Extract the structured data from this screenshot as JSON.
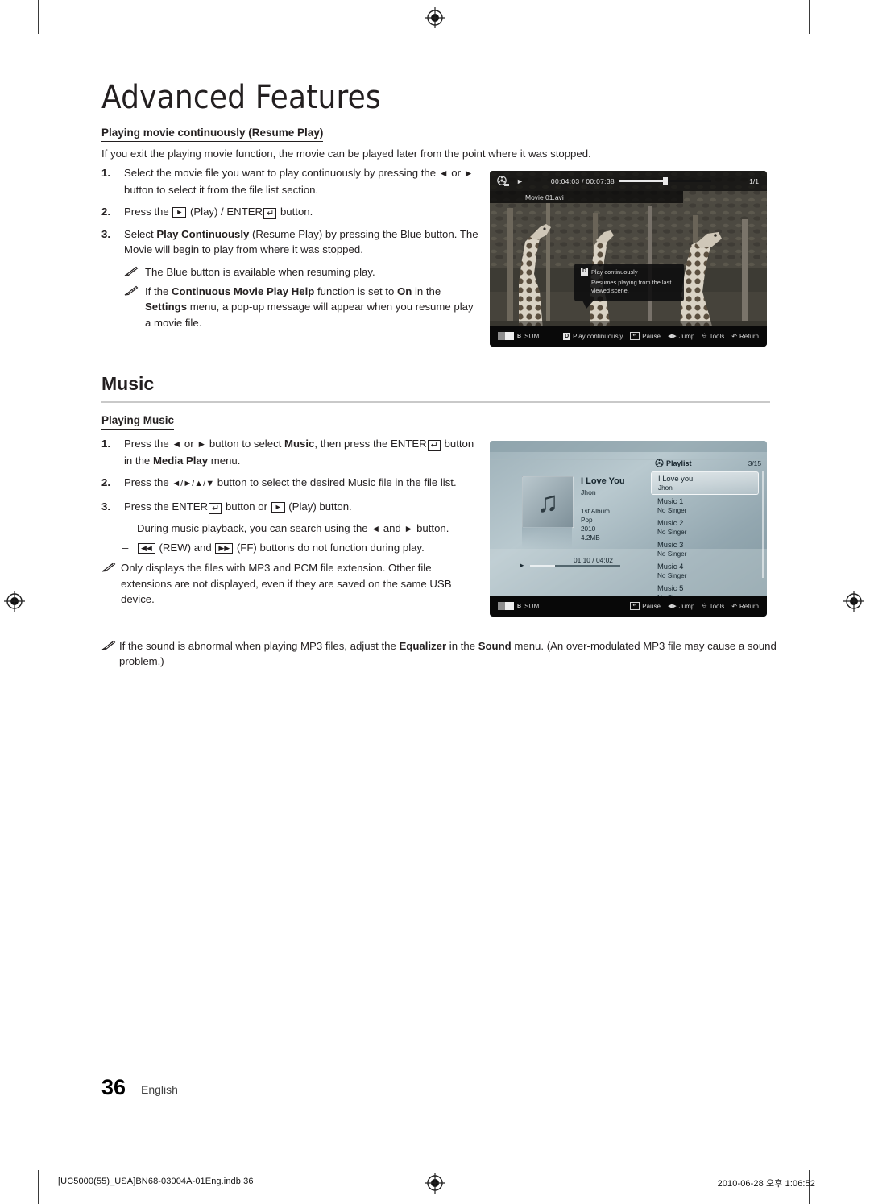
{
  "chapter": {
    "title": "Advanced Features"
  },
  "resume": {
    "heading": "Playing movie continuously (Resume Play)",
    "intro": "If you exit the playing movie function, the movie can be played later from the point where it was stopped.",
    "steps": [
      {
        "num": "1.",
        "text_a": "Select the movie file you want to play continuously by pressing the ",
        "text_b": " or ",
        "text_c": " button to select it from the file list section."
      },
      {
        "num": "2.",
        "text_a": "Press the ",
        "text_b": " (Play) / ENTER",
        "text_c": " button."
      },
      {
        "num": "3.",
        "text_a": "Select ",
        "bold": "Play Continuously",
        "text_b": " (Resume Play) by pressing the Blue button. The Movie will begin to play from where it was stopped."
      }
    ],
    "notes": [
      {
        "text": "The Blue button is available when resuming play."
      },
      {
        "pre": "If the ",
        "b1": "Continuous Movie Play Help",
        "mid": " function is set to ",
        "b2": "On",
        "mid2": " in the ",
        "b3": "Settings",
        "post": " menu, a pop-up message will appear when you resume play a movie file."
      }
    ]
  },
  "music_section": {
    "title": "Music",
    "heading": "Playing Music",
    "steps": [
      {
        "num": "1.",
        "a": "Press the ",
        "b": " or ",
        "c": " button to select ",
        "bold1": "Music",
        "d": ", then press the ENTER",
        "e": " button in the ",
        "bold2": "Media Play",
        "f": " menu."
      },
      {
        "num": "2.",
        "a": "Press the ",
        "keys": "◄/►/▲/▼",
        "c": " button to select the desired Music file in the file list."
      },
      {
        "num": "3.",
        "a": "Press the ENTER",
        "b": " button or ",
        "c": " (Play) button."
      }
    ],
    "dashes": [
      {
        "a": "During music playback, you can search using the ",
        "b": " and ",
        "c": " button."
      },
      {
        "a": " (REW) and ",
        "b": " (FF) buttons do not function during play."
      }
    ],
    "note": "Only displays the files with MP3 and PCM file extension. Other file extensions are not displayed, even if they are saved on the same USB device."
  },
  "bignote": {
    "pre": "If the sound is abnormal when playing MP3 files, adjust the ",
    "b1": "Equalizer",
    "mid": " in the ",
    "b2": "Sound",
    "post": " menu. (An over-modulated MP3 file may cause a sound problem.)"
  },
  "movie_screen": {
    "filename": "Movie 01.avi",
    "timecode": "00:04:03 / 00:07:38",
    "page_count": "1/1",
    "progress_percent": 50,
    "tooltip": {
      "badge": "D",
      "title": "Play continuously",
      "body": "Resumes playing from the last viewed scene."
    },
    "source_label": "SUM",
    "source_badge": "B",
    "buttons": [
      {
        "badge": "D",
        "label": "Play continuously"
      },
      {
        "badge": "enter",
        "label": "Pause"
      },
      {
        "badge": "lr",
        "label": "Jump"
      },
      {
        "badge": "tools",
        "label": "Tools"
      },
      {
        "badge": "return",
        "label": "Return"
      }
    ]
  },
  "music_screen": {
    "now_playing": {
      "title": "I Love You",
      "artist": "Jhon",
      "album": "1st Album",
      "genre": "Pop",
      "year": "2010",
      "size": "4.2MB",
      "time": "01:10 / 04:02",
      "progress_percent": 28
    },
    "playlist_label": "Playlist",
    "playlist_count": "3/15",
    "playlist": [
      {
        "title": "I Love you",
        "artist": "Jhon",
        "selected": true
      },
      {
        "title": "Music 1",
        "artist": "No Singer",
        "selected": false
      },
      {
        "title": "Music 2",
        "artist": "No Singer",
        "selected": false
      },
      {
        "title": "Music 3",
        "artist": "No Singer",
        "selected": false
      },
      {
        "title": "Music 4",
        "artist": "No Singer",
        "selected": false
      },
      {
        "title": "Music 5",
        "artist": "No Singer",
        "selected": false
      }
    ],
    "source_label": "SUM",
    "source_badge": "B",
    "buttons": [
      {
        "badge": "enter",
        "label": "Pause"
      },
      {
        "badge": "lr",
        "label": "Jump"
      },
      {
        "badge": "tools",
        "label": "Tools"
      },
      {
        "badge": "return",
        "label": "Return"
      }
    ]
  },
  "footer": {
    "page_number": "36",
    "language": "English",
    "file_info": "[UC5000(55)_USA]BN68-03004A-01Eng.indb   36",
    "timestamp": "2010-06-28   오후 1:06:52"
  }
}
